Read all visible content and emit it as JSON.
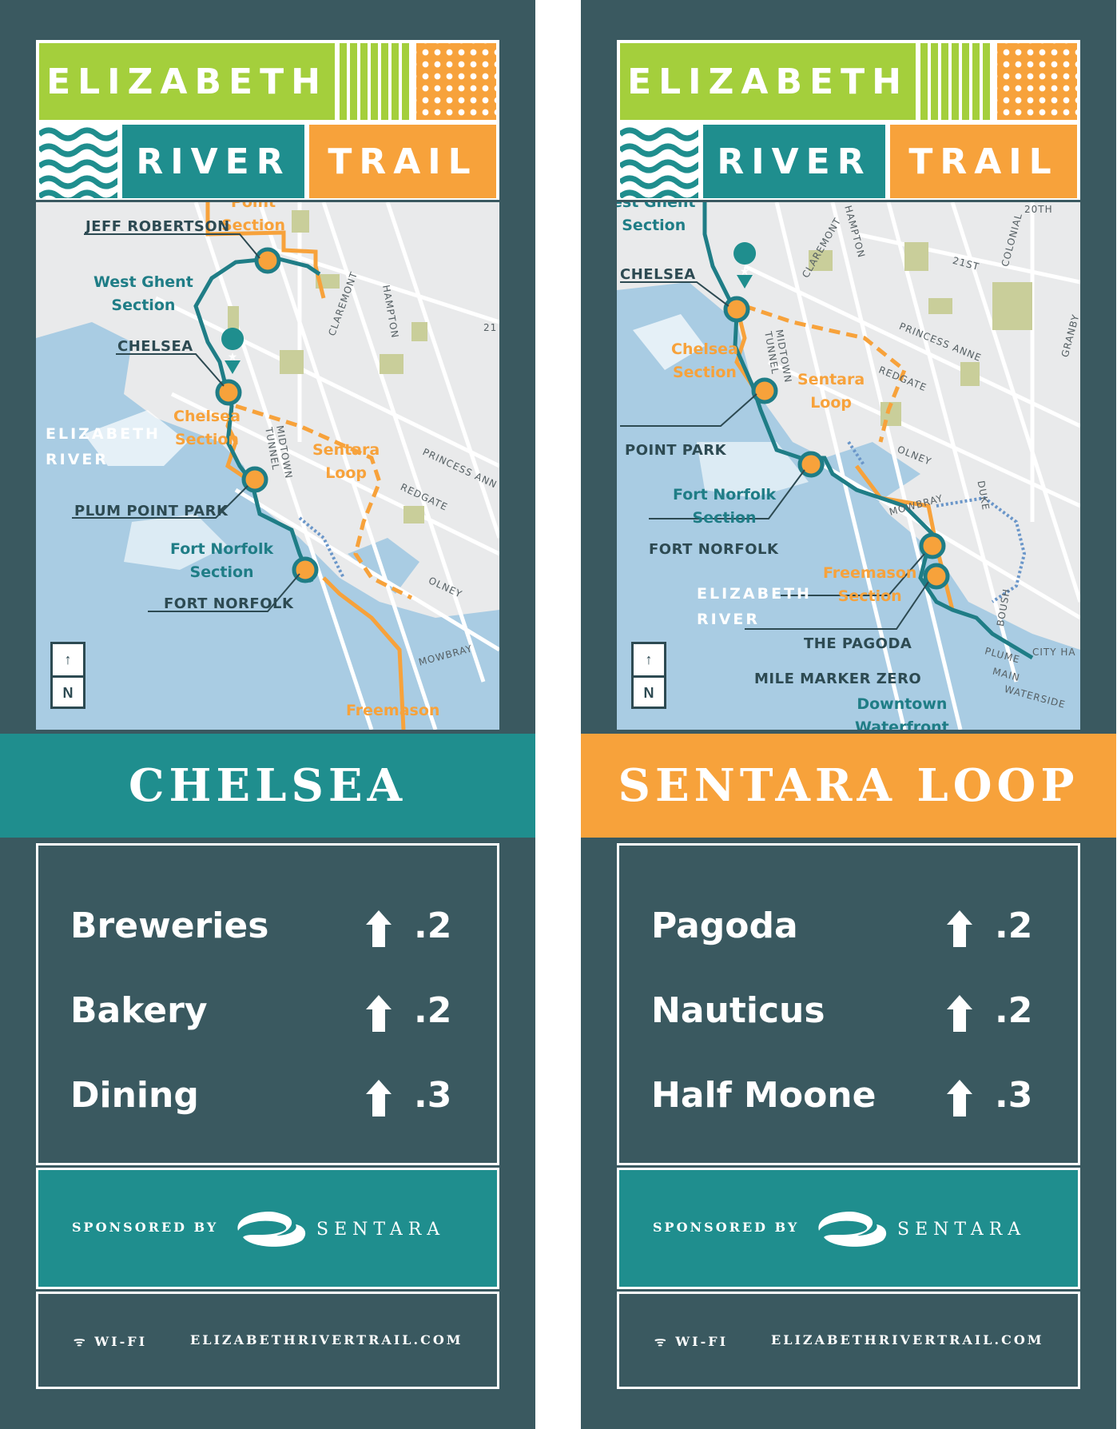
{
  "logo": {
    "line1": "ELIZABETH",
    "line2": "RIVER",
    "line3": "TRAIL"
  },
  "colors": {
    "teal": "#1f8e8e",
    "orange": "#f7a23b",
    "green": "#a4cf3c",
    "slate": "#3a5960",
    "water": "#a9cce3"
  },
  "signs": [
    {
      "banner": {
        "title": "CHELSEA",
        "color": "#1f8e8e"
      },
      "map": {
        "labels": {
          "top_section": "Point\nSection",
          "jeff": "JEFF ROBERTSON",
          "west_ghent": "West Ghent\nSection",
          "chelsea": "CHELSEA",
          "chelsea_section": "Chelsea\nSection",
          "sentara_loop": "Sentara\nLoop",
          "river": "ELIZABETH\nRIVER",
          "plum": "PLUM POINT PARK",
          "fort_norfolk_section": "Fort Norfolk\nSection",
          "fort_norfolk": "FORT NORFOLK",
          "freemason": "Freemason",
          "claremont": "CLAREMONT",
          "hampton": "HAMPTON",
          "midtown": "MIDTOWN\nTUNNEL",
          "princess": "PRINCESS ANN",
          "redgate": "REDGATE",
          "olney": "OLNEY",
          "mowbray": "MOWBRAY",
          "st21": "21"
        },
        "compass": {
          "arrow": "↑",
          "north": "N"
        }
      },
      "destinations": [
        {
          "name": "Breweries",
          "arrow_icon": "up-arrow-icon",
          "distance": ".2"
        },
        {
          "name": "Bakery",
          "arrow_icon": "up-arrow-icon",
          "distance": ".2"
        },
        {
          "name": "Dining",
          "arrow_icon": "up-arrow-icon",
          "distance": ".3"
        }
      ],
      "sponsor": {
        "label": "SPONSORED BY",
        "brand": "SENTARA",
        "mark": "®"
      },
      "footer": {
        "wifi": "WI-FI",
        "url": "ELIZABETHRIVERTRAIL.COM"
      }
    },
    {
      "banner": {
        "title": "SENTARA LOOP",
        "color": "#f7a23b"
      },
      "map": {
        "labels": {
          "top_section": "est Ghent\nSection",
          "chelsea": "CHELSEA",
          "chelsea_section": "Chelsea\nSection",
          "sentara_loop": "Sentara\nLoop",
          "point_park": "POINT PARK",
          "fort_norfolk_section": "Fort Norfolk\nSection",
          "fort_norfolk": "FORT NORFOLK",
          "freemason": "Freemason\nSection",
          "river": "ELIZABETH\nRIVER",
          "pagoda": "THE PAGODA",
          "mile": "MILE MARKER ZERO",
          "downtown": "Downtown\nWaterfront",
          "claremont": "CLAREMONT",
          "hampton": "HAMPTON",
          "colonial": "COLONIAL",
          "st21": "21ST",
          "st20": "20TH",
          "princess": "PRINCESS ANNE",
          "granby": "GRANBY",
          "redgate": "REDGATE",
          "olney": "OLNEY",
          "mowbray": "MOWBRAY",
          "duke": "DUKE",
          "boush": "BOUSH",
          "plume": "PLUME",
          "main": "MAIN",
          "waterside": "WATERSIDE",
          "city": "CITY HA",
          "midtown": "MIDTOWN\nTUNNEL"
        },
        "compass": {
          "arrow": "↑",
          "north": "N"
        }
      },
      "destinations": [
        {
          "name": "Pagoda",
          "arrow_icon": "up-arrow-icon",
          "distance": ".2"
        },
        {
          "name": "Nauticus",
          "arrow_icon": "up-arrow-icon",
          "distance": ".2"
        },
        {
          "name": "Half Moone",
          "arrow_icon": "up-arrow-icon",
          "distance": ".3"
        }
      ],
      "sponsor": {
        "label": "SPONSORED BY",
        "brand": "SENTARA",
        "mark": "®"
      },
      "footer": {
        "wifi": "WI-FI",
        "url": "ELIZABETHRIVERTRAIL.COM"
      }
    }
  ]
}
